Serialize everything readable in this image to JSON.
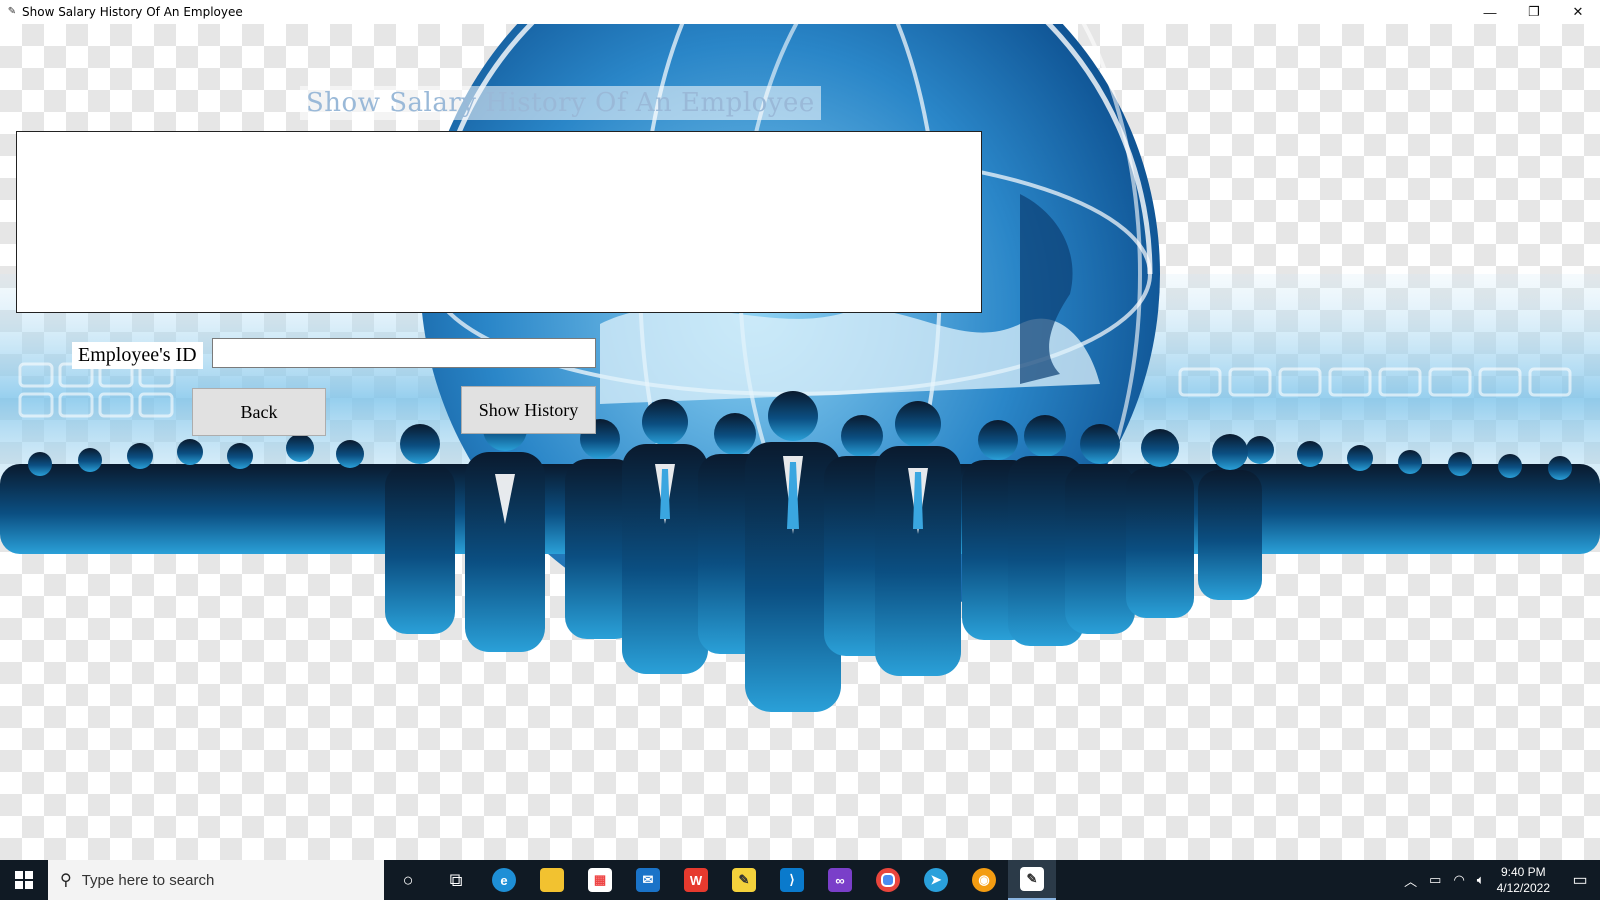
{
  "window": {
    "title": "Show Salary History Of An Employee",
    "minimize": "—",
    "restore": "❐",
    "close": "✕"
  },
  "form": {
    "heading": "Show Salary History Of An Employee",
    "history_text": "",
    "employee_id_label": "Employee's ID",
    "employee_id_value": "",
    "back_label": "Back",
    "show_history_label": "Show History"
  },
  "taskbar": {
    "search_placeholder": "Type here to search",
    "time": "9:40 PM",
    "date": "4/12/2022",
    "apps": [
      "cortana-icon",
      "task-view-icon",
      "edge-icon",
      "file-explorer-icon",
      "store-icon",
      "mail-icon",
      "wps-office-icon",
      "sticky-notes-icon",
      "vscode-icon",
      "visual-studio-icon",
      "chrome-icon",
      "telegram-icon",
      "browser-icon",
      "employee-app-icon"
    ]
  },
  "colors": {
    "heading": "#9ab9d8",
    "taskbar": "#101a24",
    "button": "#e1e1e1",
    "globe": "#2a86c8"
  }
}
